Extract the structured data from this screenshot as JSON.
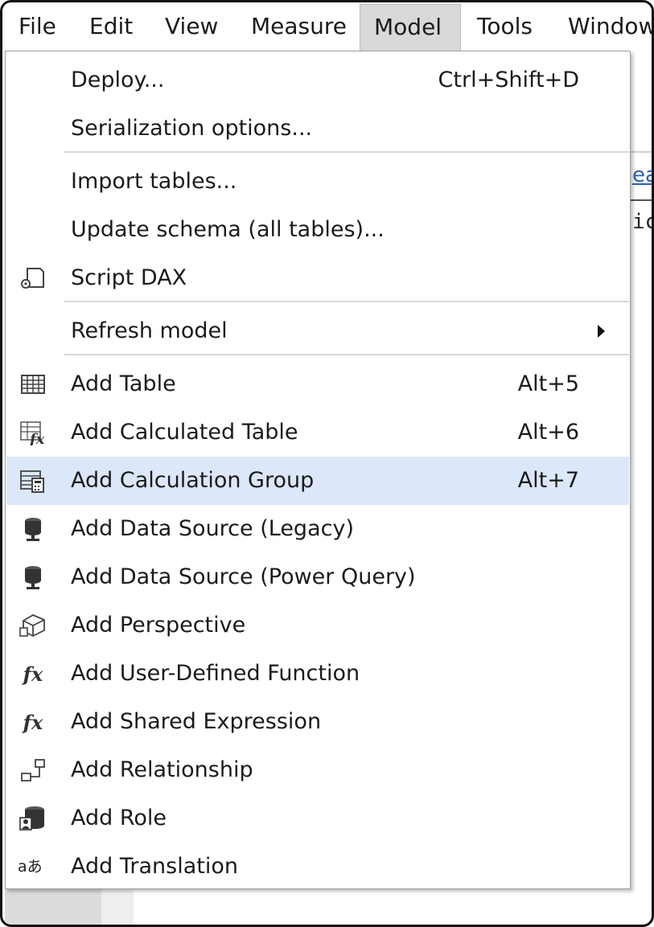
{
  "menubar": {
    "items": [
      "File",
      "Edit",
      "View",
      "Measure",
      "Model",
      "Tools",
      "Window"
    ],
    "active": "Model"
  },
  "background": {
    "link_fragment": "ea",
    "code_fragment": "ic"
  },
  "menu": {
    "deploy": {
      "label": "Deploy...",
      "shortcut": "Ctrl+Shift+D"
    },
    "serialization": {
      "label": "Serialization options..."
    },
    "import_tables": {
      "label": "Import tables..."
    },
    "update_schema": {
      "label": "Update schema (all tables)..."
    },
    "script_dax": {
      "label": "Script DAX",
      "icon": "script-icon"
    },
    "refresh_model": {
      "label": "Refresh model",
      "has_submenu": true
    },
    "add_table": {
      "label": "Add Table",
      "shortcut": "Alt+5",
      "icon": "table-icon"
    },
    "add_calculated_table": {
      "label": "Add Calculated Table",
      "shortcut": "Alt+6",
      "icon": "calculated-table-icon"
    },
    "add_calculation_group": {
      "label": "Add Calculation Group",
      "shortcut": "Alt+7",
      "icon": "calculation-group-icon",
      "highlighted": true
    },
    "add_data_source_legacy": {
      "label": "Add Data Source (Legacy)",
      "icon": "data-source-icon"
    },
    "add_data_source_pq": {
      "label": "Add Data Source (Power Query)",
      "icon": "data-source-icon"
    },
    "add_perspective": {
      "label": "Add Perspective",
      "icon": "perspective-icon"
    },
    "add_udf": {
      "label": "Add User-Defined Function",
      "icon": "fx-icon",
      "icon_text": "fx"
    },
    "add_shared_expression": {
      "label": "Add Shared Expression",
      "icon": "fx-icon",
      "icon_text": "fx"
    },
    "add_relationship": {
      "label": "Add Relationship",
      "icon": "relationship-icon"
    },
    "add_role": {
      "label": "Add Role",
      "icon": "role-icon"
    },
    "add_translation": {
      "label": "Add Translation",
      "icon": "translation-icon",
      "icon_text": "aあ"
    }
  },
  "colors": {
    "highlight": "#dce8f9",
    "active_menu": "#d9d9d9",
    "separator": "#d8d8d8"
  }
}
